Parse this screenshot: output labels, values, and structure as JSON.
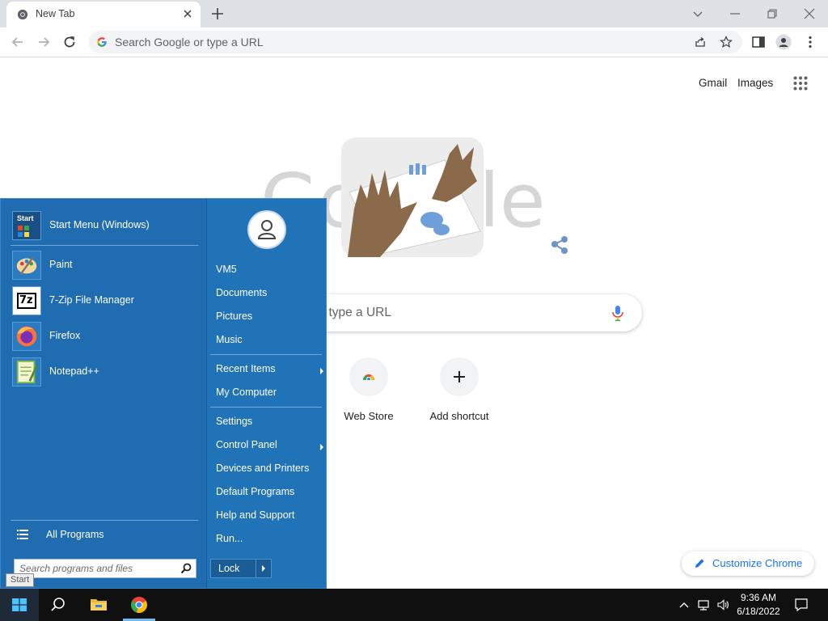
{
  "browser": {
    "tab_title": "New Tab",
    "omnibox_placeholder": "Search Google or type a URL",
    "icons": [
      "chrome-favicon",
      "close-icon",
      "plus-icon",
      "chevron-down-icon",
      "minimize-icon",
      "restore-icon",
      "close-window-icon",
      "back-arrow-icon",
      "forward-arrow-icon",
      "reload-icon",
      "google-g-icon",
      "share-icon",
      "star-icon",
      "side-panel-icon",
      "profile-icon",
      "more-vert-icon"
    ]
  },
  "ntp": {
    "gmail_label": "Gmail",
    "images_label": "Images",
    "search_placeholder_visible": "r type a URL",
    "shortcuts": [
      {
        "label": "Web Store",
        "icon": "web-store-icon"
      },
      {
        "label": "Add shortcut",
        "icon": "plus-icon"
      }
    ],
    "customize_label": "Customize Chrome",
    "doodle_partial_text": [
      "Go",
      "gle"
    ]
  },
  "start_menu": {
    "pinned": [
      {
        "label": "Start Menu (Windows)",
        "icon": "start-menu-app-icon"
      },
      {
        "label": "Paint",
        "icon": "paint-icon"
      },
      {
        "label": "7-Zip File Manager",
        "icon": "7zip-icon"
      },
      {
        "label": "Firefox",
        "icon": "firefox-icon"
      },
      {
        "label": "Notepad++",
        "icon": "notepadpp-icon"
      }
    ],
    "start_app_icon_text": "Start",
    "sevenzip_icon_text": "7z",
    "all_programs_label": "All Programs",
    "search_placeholder": "Search programs and files",
    "right_items": [
      {
        "label": "VM5",
        "has_submenu": false
      },
      {
        "label": "Documents",
        "has_submenu": false
      },
      {
        "label": "Pictures",
        "has_submenu": false
      },
      {
        "label": "Music",
        "has_submenu": false
      },
      {
        "label": "Recent Items",
        "has_submenu": true
      },
      {
        "label": "My Computer",
        "has_submenu": false
      },
      {
        "label": "Settings",
        "has_submenu": false
      },
      {
        "label": "Control Panel",
        "has_submenu": true
      },
      {
        "label": "Devices and Printers",
        "has_submenu": false
      },
      {
        "label": "Default Programs",
        "has_submenu": false
      },
      {
        "label": "Help and Support",
        "has_submenu": false
      },
      {
        "label": "Run...",
        "has_submenu": false
      }
    ],
    "lock_label": "Lock",
    "tooltip": "Start"
  },
  "taskbar": {
    "icons": [
      "windows-start-icon",
      "search-icon",
      "file-explorer-icon",
      "chrome-icon"
    ],
    "tray_icons": [
      "chevron-up-icon",
      "network-icon",
      "volume-icon"
    ],
    "time": "9:36 AM",
    "date": "6/18/2022",
    "notification_icon": "notification-icon"
  },
  "colors": {
    "start_menu_bg": "#1f6db0",
    "accent_blue": "#1a73e8",
    "taskbar_bg": "#101010"
  }
}
